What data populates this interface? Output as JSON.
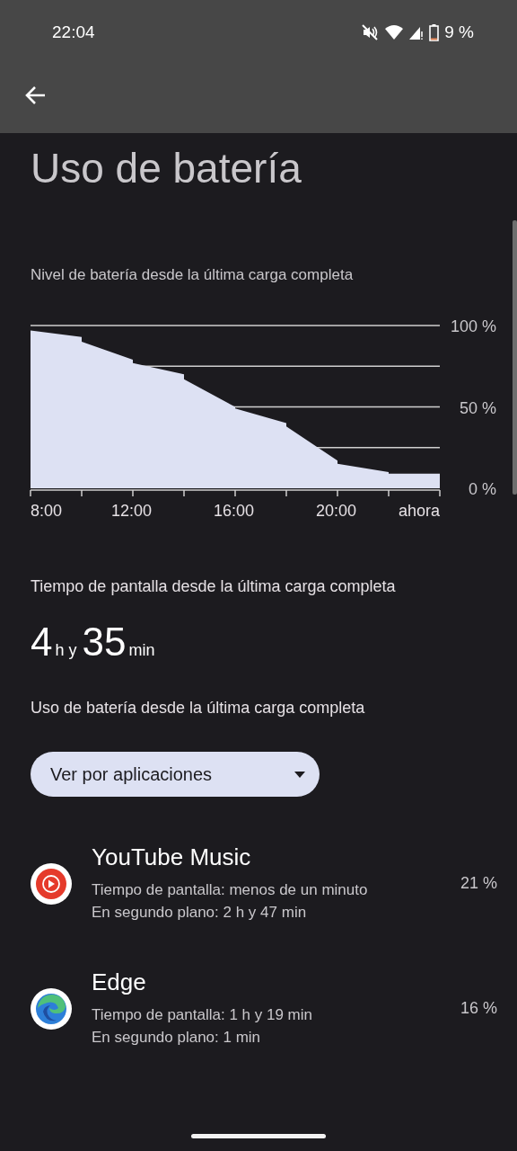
{
  "status_bar": {
    "time": "22:04",
    "battery": "9 %"
  },
  "title": "Uso de batería",
  "battery_chart": {
    "caption": "Nivel de batería desde la última carga completa",
    "chart_data": {
      "type": "area",
      "x": [
        8,
        10,
        10,
        12,
        12,
        14,
        14,
        16,
        16,
        18,
        18,
        20,
        20,
        22,
        22,
        24
      ],
      "series": [
        {
          "color": "#dde1f3",
          "values": [
            97,
            93,
            90,
            79,
            77,
            70,
            67,
            50,
            49,
            40,
            38,
            17,
            15,
            10,
            9,
            9
          ]
        }
      ],
      "grid": true,
      "xlim": [
        8,
        24
      ],
      "ylim": [
        0,
        100
      ],
      "xticks": [
        {
          "value": 8,
          "label": "8:00"
        },
        {
          "value": 12,
          "label": "12:00"
        },
        {
          "value": 16,
          "label": "16:00"
        },
        {
          "value": 20,
          "label": "20:00"
        },
        {
          "value": 24,
          "label": "ahora"
        }
      ],
      "yticks": [
        {
          "value": 0,
          "label": "0 %"
        },
        {
          "value": 50,
          "label": "50 %"
        },
        {
          "value": 100,
          "label": "100 %"
        }
      ]
    }
  },
  "screen_time": {
    "caption": "Tiempo de pantalla desde la última carga completa",
    "hours": "4",
    "hours_unit": "h y",
    "minutes": "35",
    "minutes_unit": "min"
  },
  "usage": {
    "caption": "Uso de batería desde la última carga completa",
    "dropdown": "Ver por aplicaciones"
  },
  "apps": [
    {
      "kind": "youtube-music",
      "name": "YouTube Music",
      "lines": [
        "Tiempo de pantalla: menos de un minuto",
        "En segundo plano: 2 h y 47 min"
      ],
      "percent": "21 %"
    },
    {
      "kind": "edge",
      "name": "Edge",
      "lines": [
        "Tiempo de pantalla: 1 h y 19 min",
        "En segundo plano: 1 min"
      ],
      "percent": "16 %"
    }
  ]
}
